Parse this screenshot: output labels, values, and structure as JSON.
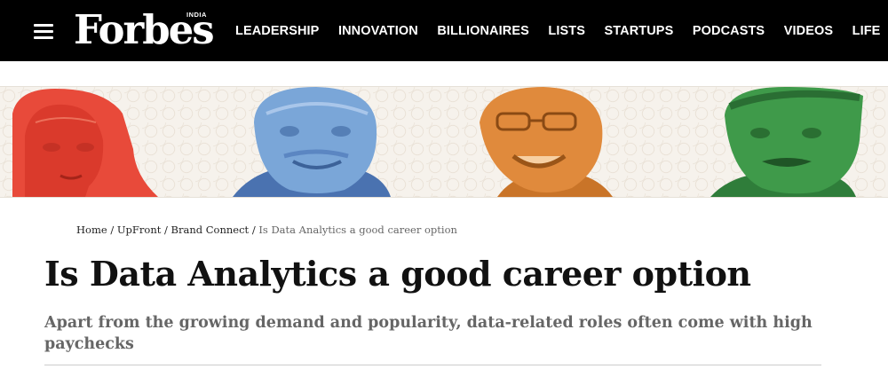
{
  "header": {
    "menu_icon": "hamburger-menu-icon",
    "logo_text": "Forbes",
    "logo_edition": "INDIA",
    "nav_items": [
      "LEADERSHIP",
      "INNOVATION",
      "BILLIONAIRES",
      "LISTS",
      "STARTUPS",
      "PODCASTS",
      "VIDEOS",
      "LIFE"
    ]
  },
  "banner": {
    "portraits": [
      {
        "icon": "portrait-illustration",
        "tint": "#e84a3a"
      },
      {
        "icon": "portrait-illustration",
        "tint": "#7aa6d8"
      },
      {
        "icon": "portrait-illustration",
        "tint": "#e08a3c"
      },
      {
        "icon": "portrait-illustration",
        "tint": "#3f9a4a"
      }
    ]
  },
  "breadcrumb": {
    "items": [
      "Home",
      "UpFront",
      "Brand Connect"
    ],
    "separator": " / ",
    "current": "Is Data Analytics a good career option"
  },
  "article": {
    "title": "Is Data Analytics a good career option",
    "subtitle": "Apart from the growing demand and popularity, data-related roles often come with high paychecks"
  },
  "colors": {
    "header_bg": "#000000",
    "header_text": "#ffffff",
    "title_text": "#111111",
    "subtitle_text": "#666666"
  }
}
